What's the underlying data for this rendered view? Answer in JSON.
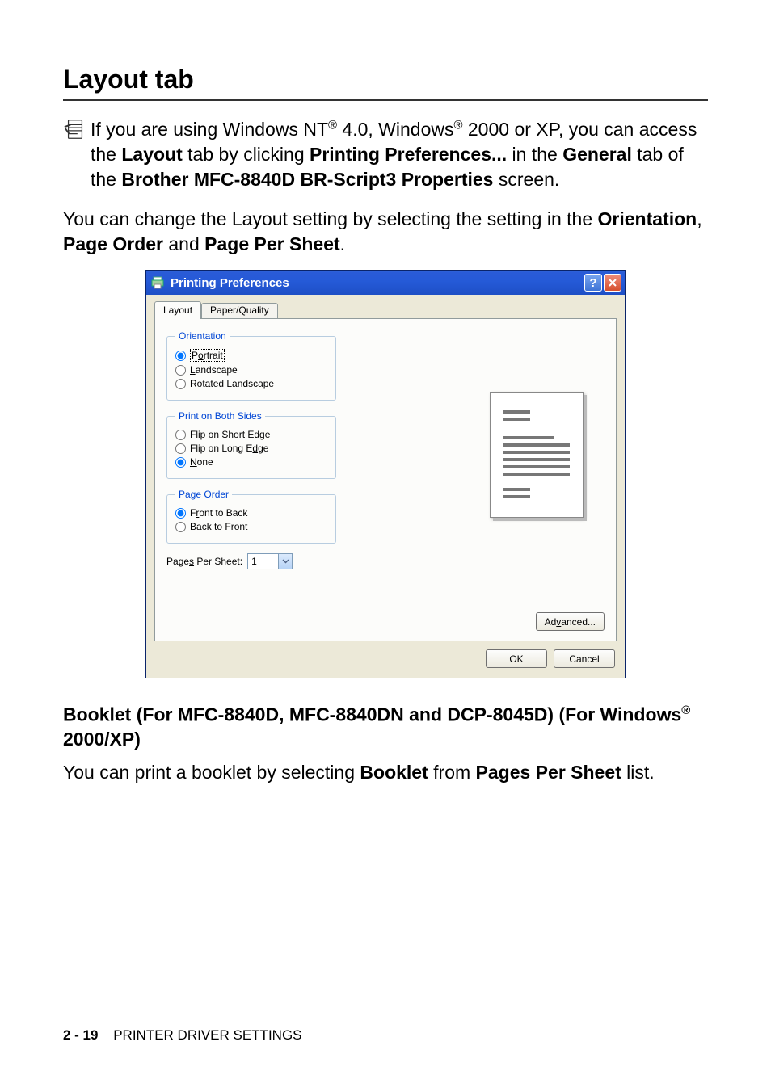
{
  "headings": {
    "h1": "Layout tab",
    "h2_line1": "Booklet (For MFC-8840D, MFC-8840DN and DCP-8045D) (For Windows",
    "h2_reg": "®",
    "h2_line2": " 2000/XP)"
  },
  "note": {
    "t1": "If you are using Windows NT",
    "reg1": "®",
    "t2": " 4.0, Windows",
    "reg2": "®",
    "t3": " 2000 or XP, you can access the ",
    "b1": "Layout",
    "t4": " tab by clicking ",
    "b2": "Printing Preferences...",
    "t5": " in the ",
    "b3": "General",
    "t6": " tab of the ",
    "b4": "Brother MFC-8840D BR-Script3 Properties",
    "t7": " screen."
  },
  "para1": {
    "t1": "You can change the Layout setting by selecting the setting in the ",
    "b1": "Orientation",
    "t2": ", ",
    "b2": "Page Order",
    "t3": " and ",
    "b3": "Page Per Sheet",
    "t4": "."
  },
  "para2": {
    "t1": "You can print a booklet by selecting ",
    "b1": "Booklet",
    "t2": " from ",
    "b2": "Pages Per Sheet",
    "t3": " list."
  },
  "dialog": {
    "title": "Printing Preferences",
    "tabs": {
      "layout": "Layout",
      "pq": "Paper/Quality"
    },
    "orientation": {
      "legend": "Orientation",
      "portrait_pre": "P",
      "portrait_u": "o",
      "portrait_post": "rtrait",
      "landscape_u": "L",
      "landscape_post": "andscape",
      "rotated_pre": "Rotat",
      "rotated_u": "e",
      "rotated_post": "d Landscape"
    },
    "duplex": {
      "legend": "Print on Both Sides",
      "short_pre": "Flip on Shor",
      "short_u": "t",
      "short_post": " Edge",
      "long_pre": "Flip on Long E",
      "long_u": "d",
      "long_post": "ge",
      "none_u": "N",
      "none_post": "one"
    },
    "pageorder": {
      "legend": "Page Order",
      "ftb_pre": "F",
      "ftb_u": "r",
      "ftb_post": "ont to Back",
      "btf_u": "B",
      "btf_post": "ack to Front"
    },
    "pps": {
      "label_pre": "Page",
      "label_u": "s",
      "label_post": " Per Sheet:",
      "value": "1"
    },
    "buttons": {
      "advanced_pre": "Ad",
      "advanced_u": "v",
      "advanced_post": "anced...",
      "ok": "OK",
      "cancel": "Cancel"
    }
  },
  "footer": {
    "page": "2 - 19",
    "section": "PRINTER DRIVER SETTINGS"
  }
}
